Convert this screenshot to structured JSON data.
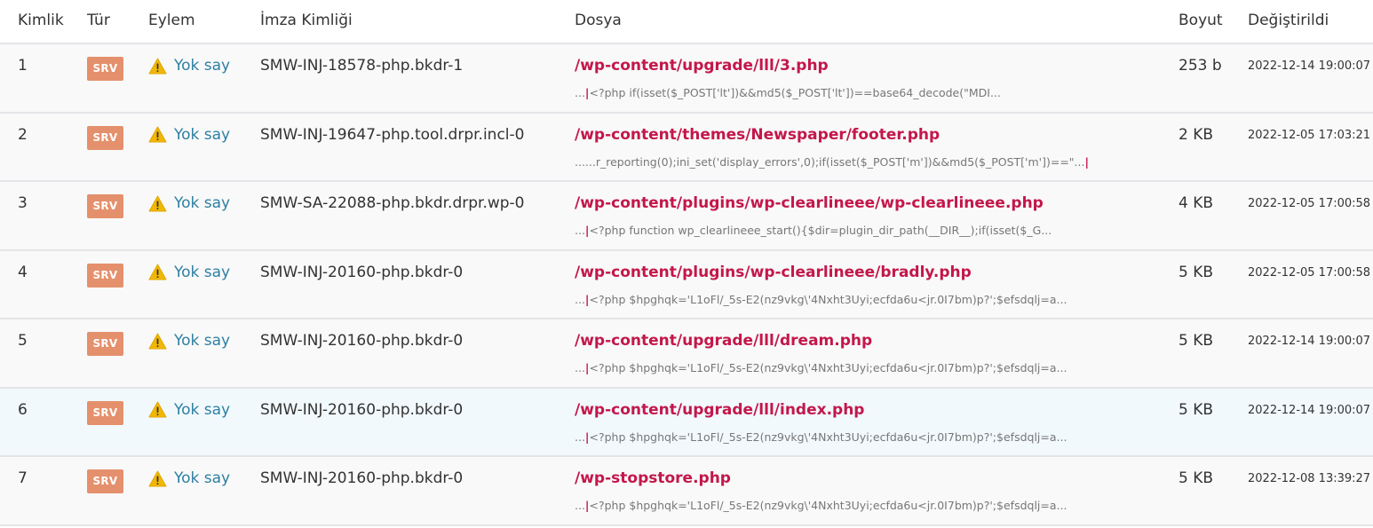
{
  "headers": {
    "id": "Kimlik",
    "type": "Tür",
    "action": "Eylem",
    "signature": "İmza Kimliği",
    "file": "Dosya",
    "size": "Boyut",
    "modified": "Değiştirildi"
  },
  "colors": {
    "badge": "#e5906c",
    "file_link": "#c3174b",
    "action_link": "#2d7fa3",
    "warning_icon": "#f2b705",
    "highlight_row": "#f1f9fd"
  },
  "action_icon": "warning-triangle-icon",
  "rows": [
    {
      "id": "1",
      "type": "SRV",
      "action": "Yok say",
      "signature": "SMW-INJ-18578-php.bkdr-1",
      "file": "/wp-content/upgrade/lll/3.php",
      "snippet_prefix": "...",
      "snippet": "<?php if(isset($_POST['lt'])&&md5($_POST['lt'])==base64_decode(\"MDI...",
      "size": "253 b",
      "modified": "2022-12-14 19:00:07"
    },
    {
      "id": "2",
      "type": "SRV",
      "action": "Yok say",
      "signature": "SMW-INJ-19647-php.tool.drpr.incl-0",
      "file": "/wp-content/themes/Newspaper/footer.php",
      "snippet_prefix": "......r_reporting(0);ini_set('display_errors',0);if(isset($_POST['m'])&&md5($_POST['m'])==\"...",
      "snippet": "",
      "size": "2 KB",
      "modified": "2022-12-05 17:03:21"
    },
    {
      "id": "3",
      "type": "SRV",
      "action": "Yok say",
      "signature": "SMW-SA-22088-php.bkdr.drpr.wp-0",
      "file": "/wp-content/plugins/wp-clearlineee/wp-clearlineee.php",
      "snippet_prefix": "...",
      "snippet": "<?php function wp_clearlineee_start(){$dir=plugin_dir_path(__DIR__);if(isset($_G...",
      "size": "4 KB",
      "modified": "2022-12-05 17:00:58"
    },
    {
      "id": "4",
      "type": "SRV",
      "action": "Yok say",
      "signature": "SMW-INJ-20160-php.bkdr-0",
      "file": "/wp-content/plugins/wp-clearlineee/bradly.php",
      "snippet_prefix": "...",
      "snippet": "<?php $hpghqk='L1oFl/_5s-E2(nz9vkg\\'4Nxht3Uyi;ecfda6u<jr.0I7bm)p?';$efsdqlj=a...",
      "size": "5 KB",
      "modified": "2022-12-05 17:00:58"
    },
    {
      "id": "5",
      "type": "SRV",
      "action": "Yok say",
      "signature": "SMW-INJ-20160-php.bkdr-0",
      "file": "/wp-content/upgrade/lll/dream.php",
      "snippet_prefix": "...",
      "snippet": "<?php $hpghqk='L1oFl/_5s-E2(nz9vkg\\'4Nxht3Uyi;ecfda6u<jr.0I7bm)p?';$efsdqlj=a...",
      "size": "5 KB",
      "modified": "2022-12-14 19:00:07"
    },
    {
      "id": "6",
      "type": "SRV",
      "action": "Yok say",
      "signature": "SMW-INJ-20160-php.bkdr-0",
      "file": "/wp-content/upgrade/lll/index.php",
      "snippet_prefix": "...",
      "snippet": "<?php $hpghqk='L1oFl/_5s-E2(nz9vkg\\'4Nxht3Uyi;ecfda6u<jr.0I7bm)p?';$efsdqlj=a...",
      "size": "5 KB",
      "modified": "2022-12-14 19:00:07"
    },
    {
      "id": "7",
      "type": "SRV",
      "action": "Yok say",
      "signature": "SMW-INJ-20160-php.bkdr-0",
      "file": "/wp-stopstore.php",
      "snippet_prefix": "...",
      "snippet": "<?php $hpghqk='L1oFl/_5s-E2(nz9vkg\\'4Nxht3Uyi;ecfda6u<jr.0I7bm)p?';$efsdqlj=a...",
      "size": "5 KB",
      "modified": "2022-12-08 13:39:27"
    }
  ]
}
